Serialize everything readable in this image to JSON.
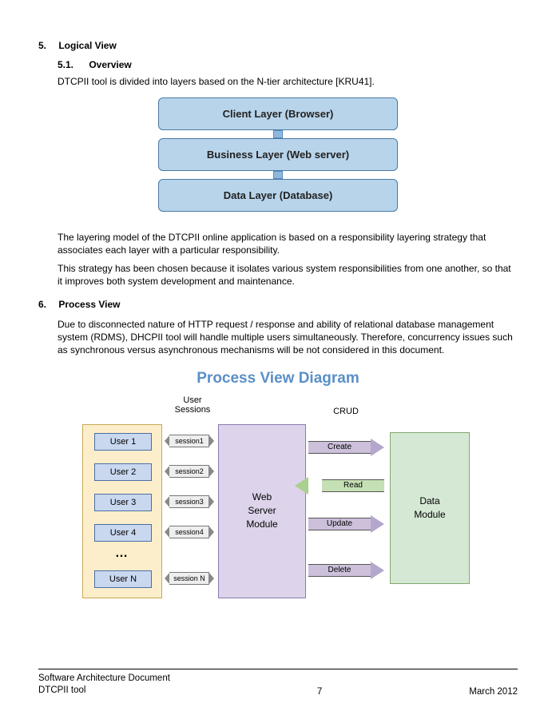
{
  "section5": {
    "num": "5.",
    "title": "Logical View",
    "sub": {
      "num": "5.1.",
      "title": "Overview"
    },
    "intro": "DTCPII tool is divided into layers based on the N-tier architecture [KRU41].",
    "layers": {
      "client": "Client Layer (Browser)",
      "business": "Business Layer (Web server)",
      "data": "Data Layer (Database)"
    },
    "para1": "The layering model of the DTCPII online application is based on a responsibility layering strategy that associates each layer with a particular responsibility.",
    "para2": "This strategy has been chosen because it isolates various system responsibilities from one another, so that it improves both system development and maintenance."
  },
  "section6": {
    "num": "6.",
    "title": "Process View",
    "para": "Due to disconnected nature of HTTP request / response and ability of relational database management system (RDMS), DHCPII tool will handle multiple users simultaneously. Therefore, concurrency issues such as synchronous versus asynchronous mechanisms will be not considered in this document.",
    "diagram_title": "Process View Diagram",
    "labels": {
      "sessions": "User\nSessions",
      "crud": "CRUD"
    },
    "users": [
      "User 1",
      "User 2",
      "User 3",
      "User 4",
      "User N"
    ],
    "dots": "…",
    "sessions": [
      "session1",
      "session2",
      "session3",
      "session4",
      "session N"
    ],
    "web_server": "Web\nServer\nModule",
    "crud_ops": [
      "Create",
      "Read",
      "Update",
      "Delete"
    ],
    "data_module": "Data\nModule"
  },
  "footer": {
    "doc": "Software Architecture Document",
    "tool": "DTCPII tool",
    "page": "7",
    "date": "March 2012"
  }
}
